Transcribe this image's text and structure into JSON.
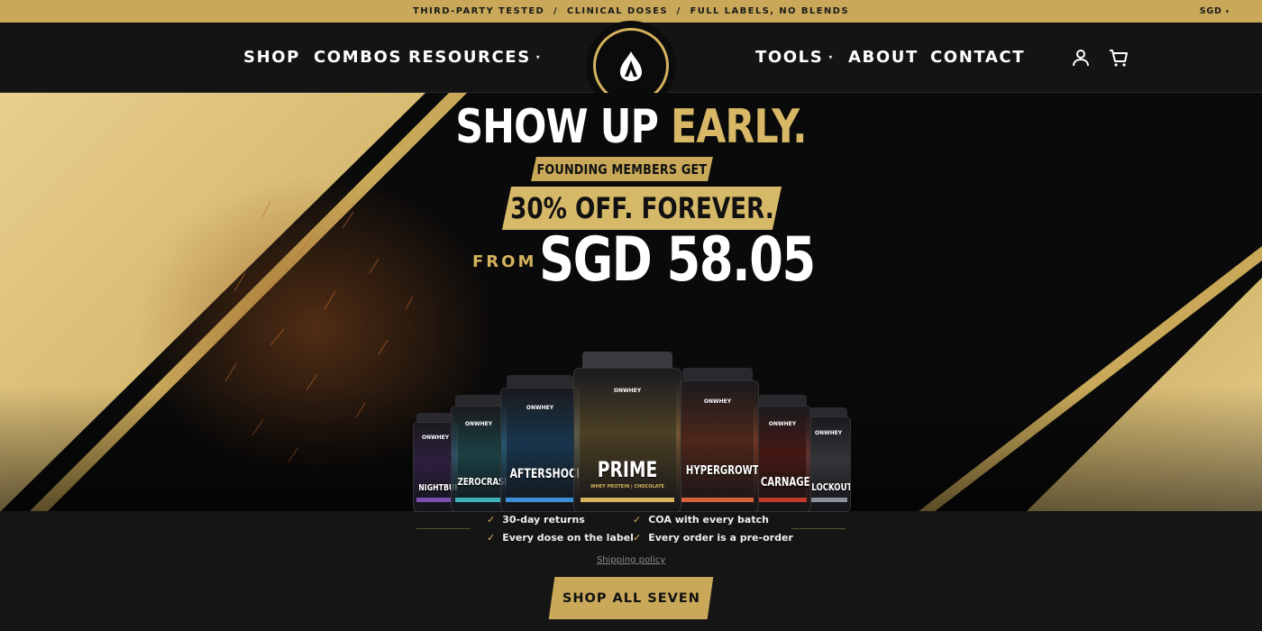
{
  "announcement": {
    "text": "THIRD-PARTY TESTED  /  CLINICAL DOSES  /  FULL LABELS, NO BLENDS",
    "currency": "SGD",
    "currency_caret": "▾"
  },
  "nav": {
    "left": [
      {
        "label": "SHOP"
      },
      {
        "label": "COMBOS"
      },
      {
        "label": "RESOURCES",
        "dropdown": "▾"
      }
    ],
    "right": [
      {
        "label": "TOOLS",
        "dropdown": "▾"
      },
      {
        "label": "ABOUT"
      },
      {
        "label": "CONTACT"
      }
    ],
    "icons": [
      "account-icon",
      "cart-icon"
    ]
  },
  "hero": {
    "headline_white": "SHOW UP ",
    "headline_gold": "EARLY.",
    "tag_small": "FOUNDING MEMBERS GET",
    "tag_large": "30% OFF. FOREVER.",
    "from_label": "FROM",
    "price": "SGD 58.05"
  },
  "products": [
    {
      "name": "NIGHTBURN",
      "accent": "#7a4fb0",
      "brand": "ONWHEY"
    },
    {
      "name": "ZEROCRASH",
      "accent": "#3fb0b8",
      "brand": "ONWHEY"
    },
    {
      "name": "AFTERSHOCK",
      "accent": "#3a8fd6",
      "brand": "ONWHEY"
    },
    {
      "name": "PRIME",
      "accent": "#d4b25e",
      "brand": "ONWHEY",
      "sub": "WHEY PROTEIN | CHOCOLATE"
    },
    {
      "name": "HYPERGROWTH",
      "accent": "#d6643a",
      "brand": "ONWHEY"
    },
    {
      "name": "CARNAGE",
      "accent": "#c0392b",
      "brand": "ONWHEY"
    },
    {
      "name": "LOCKOUT",
      "accent": "#8a8f99",
      "brand": "ONWHEY"
    }
  ],
  "perks": [
    "30-day returns",
    "COA with every batch",
    "Every dose on the label",
    "Every order is a pre-order"
  ],
  "shipping_link": "Shipping policy",
  "cta": "SHOP ALL SEVEN",
  "colors": {
    "gold": "#c9a959",
    "dark": "#0b0b0b"
  }
}
